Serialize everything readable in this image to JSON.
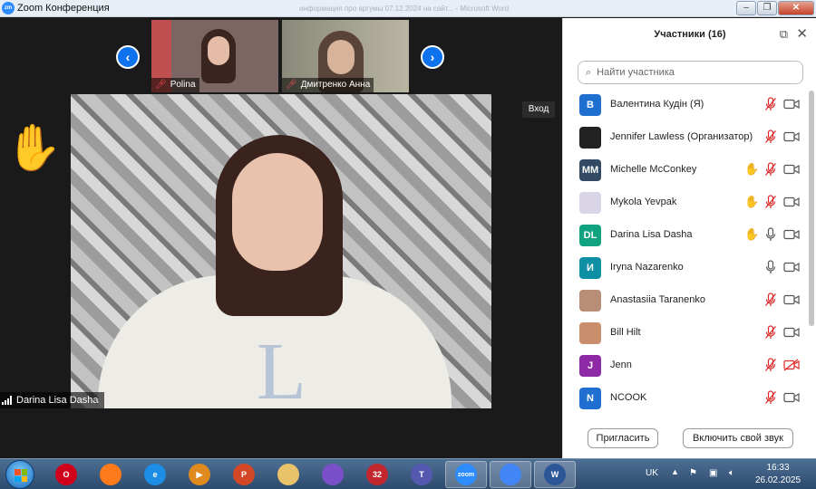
{
  "window": {
    "title": "Zoom Конференция",
    "app_icon": "zm",
    "background_window_text": "информация про аргумы 07.12.2024 на сайт... - Microsoft Word"
  },
  "video": {
    "thumbnails": [
      {
        "name": "Polina",
        "muted": true
      },
      {
        "name": "Дмитренко Анна",
        "muted": true
      }
    ],
    "entry_label": "Вход",
    "speaker_name": "Darina Lisa Dasha",
    "raised_hand": true,
    "shirt_letter": "L"
  },
  "panel": {
    "title": "Участники (16)",
    "search_placeholder": "Найти участника",
    "participants": [
      {
        "name": "Валентина Кудін (Я)",
        "avatar": "В",
        "avatar_color": "#1f6fd1",
        "hand": false,
        "mic": "muted",
        "cam": "on"
      },
      {
        "name": "Jennifer Lawless (Организатор)",
        "avatar": "",
        "avatar_color": "#222222",
        "hand": false,
        "mic": "muted",
        "cam": "on"
      },
      {
        "name": "Michelle McConkey",
        "avatar": "MM",
        "avatar_color": "#324a63",
        "hand": true,
        "mic": "muted",
        "cam": "on"
      },
      {
        "name": "Mykola Yevpak",
        "avatar": "",
        "avatar_color": "#d9d4e6",
        "hand": true,
        "mic": "muted",
        "cam": "on"
      },
      {
        "name": "Darina Lisa Dasha",
        "avatar": "DL",
        "avatar_color": "#11a37f",
        "hand": true,
        "mic": "on",
        "cam": "on"
      },
      {
        "name": "Iryna Nazarenko",
        "avatar": "И",
        "avatar_color": "#0e8fa3",
        "hand": false,
        "mic": "on",
        "cam": "on"
      },
      {
        "name": "Anastasiia Taranenko",
        "avatar": "",
        "avatar_color": "#b88f76",
        "hand": false,
        "mic": "muted",
        "cam": "on"
      },
      {
        "name": "Bill Hilt",
        "avatar": "",
        "avatar_color": "#c98f6c",
        "hand": false,
        "mic": "muted",
        "cam": "on"
      },
      {
        "name": "Jenn",
        "avatar": "J",
        "avatar_color": "#8e2aa6",
        "hand": false,
        "mic": "muted",
        "cam": "off"
      },
      {
        "name": "NCOOK",
        "avatar": "N",
        "avatar_color": "#1f6fd1",
        "hand": false,
        "mic": "muted",
        "cam": "on"
      }
    ],
    "invite_label": "Пригласить",
    "unmute_label": "Включить свой звук"
  },
  "taskbar": {
    "apps": [
      {
        "name": "opera",
        "label": "O",
        "color": "#d0021b",
        "active": false
      },
      {
        "name": "firefox",
        "label": "",
        "color": "#ff7a1a",
        "active": false
      },
      {
        "name": "internet-explorer",
        "label": "e",
        "color": "#1c8ee6",
        "active": false
      },
      {
        "name": "media-player",
        "label": "▶",
        "color": "#e08a1e",
        "active": false
      },
      {
        "name": "powerpoint",
        "label": "P",
        "color": "#d24726",
        "active": false
      },
      {
        "name": "file-explorer",
        "label": "",
        "color": "#e8c36a",
        "active": false
      },
      {
        "name": "viber",
        "label": "",
        "color": "#7a4fc9",
        "active": false
      },
      {
        "name": "game",
        "label": "32",
        "color": "#c1272d",
        "active": false
      },
      {
        "name": "teams",
        "label": "T",
        "color": "#5558af",
        "active": false
      },
      {
        "name": "zoom",
        "label": "zoom",
        "color": "#2d8cff",
        "active": true
      },
      {
        "name": "chrome",
        "label": "",
        "color": "#4285f4",
        "active": true
      },
      {
        "name": "word",
        "label": "W",
        "color": "#2b579a",
        "active": true
      }
    ],
    "language": "UK",
    "time": "16:33",
    "date": "26.02.2025"
  }
}
